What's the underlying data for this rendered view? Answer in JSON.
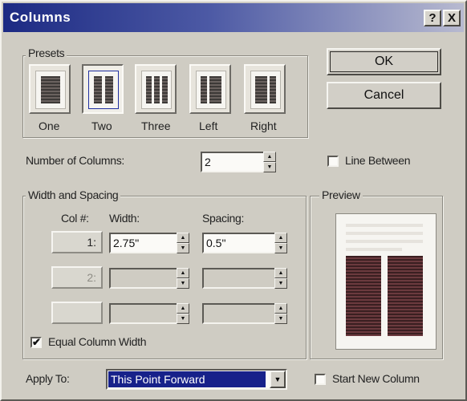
{
  "title": "Columns",
  "title_buttons": {
    "help": "?",
    "close": "X"
  },
  "presets": {
    "legend": "Presets",
    "items": [
      {
        "label": "One",
        "columns": 1,
        "selected": false
      },
      {
        "label": "Two",
        "columns": 2,
        "selected": true
      },
      {
        "label": "Three",
        "columns": 3,
        "selected": false
      },
      {
        "label": "Left",
        "columns": 2,
        "selected": false
      },
      {
        "label": "Right",
        "columns": 2,
        "selected": false
      }
    ]
  },
  "buttons": {
    "ok": "OK",
    "cancel": "Cancel"
  },
  "number_of_columns": {
    "label": "Number of Columns:",
    "value": "2"
  },
  "line_between": {
    "label": "Line Between",
    "checked": false
  },
  "width_spacing": {
    "legend": "Width and Spacing",
    "headers": {
      "col": "Col #:",
      "width": "Width:",
      "spacing": "Spacing:"
    },
    "rows": [
      {
        "col": "1:",
        "width": "2.75\"",
        "spacing": "0.5\"",
        "enabled": true
      },
      {
        "col": "2:",
        "width": "",
        "spacing": "",
        "enabled": false
      },
      {
        "col": "",
        "width": "",
        "spacing": "",
        "enabled": false
      }
    ]
  },
  "preview": {
    "legend": "Preview"
  },
  "equal_width": {
    "label": "Equal Column Width",
    "checked": true,
    "mark": "✔"
  },
  "apply_to": {
    "label": "Apply To:",
    "value": "This Point Forward"
  },
  "start_new_column": {
    "label": "Start New Column",
    "checked": false
  },
  "colors": {
    "title_gradient_start": "#1c2a83",
    "dialog_bg": "#cfccc3",
    "selection": "#17218a",
    "preview_columns": "#4a2b2e"
  }
}
